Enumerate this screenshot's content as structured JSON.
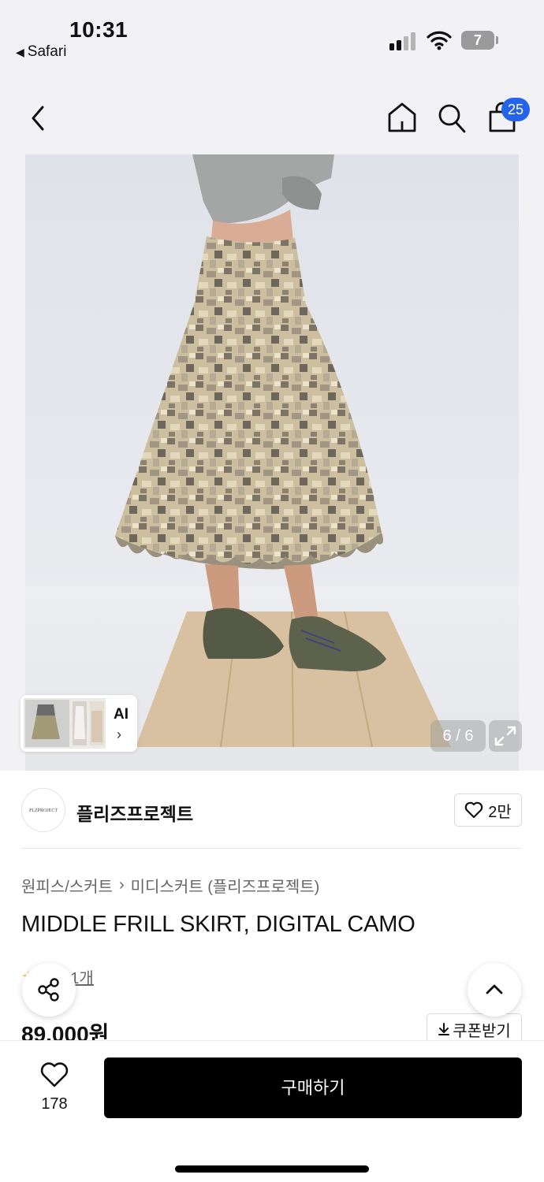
{
  "status_bar": {
    "time": "10:31",
    "back_app": "Safari",
    "battery_level": "7"
  },
  "nav": {
    "cart_count": "25"
  },
  "gallery": {
    "thumbnail_label": "AI",
    "counter": "6 / 6"
  },
  "brand": {
    "logo_text": "PLZPROJECT",
    "name": "플리즈프로젝트",
    "like_count": "2만"
  },
  "product": {
    "breadcrumb": [
      "원피스/스커트",
      "미디스커트 (플리즈프로젝트)"
    ],
    "title": "MIDDLE FRILL SKIRT, DIGITAL CAMO",
    "review_text": "후기 1개",
    "price": "89,000원",
    "coupon_label": "쿠폰받기"
  },
  "bottom_bar": {
    "wish_count": "178",
    "buy_label": "구매하기"
  },
  "colors": {
    "accent_badge": "#2563eb",
    "buy_button": "#000000",
    "background": "#f2f2f4"
  }
}
